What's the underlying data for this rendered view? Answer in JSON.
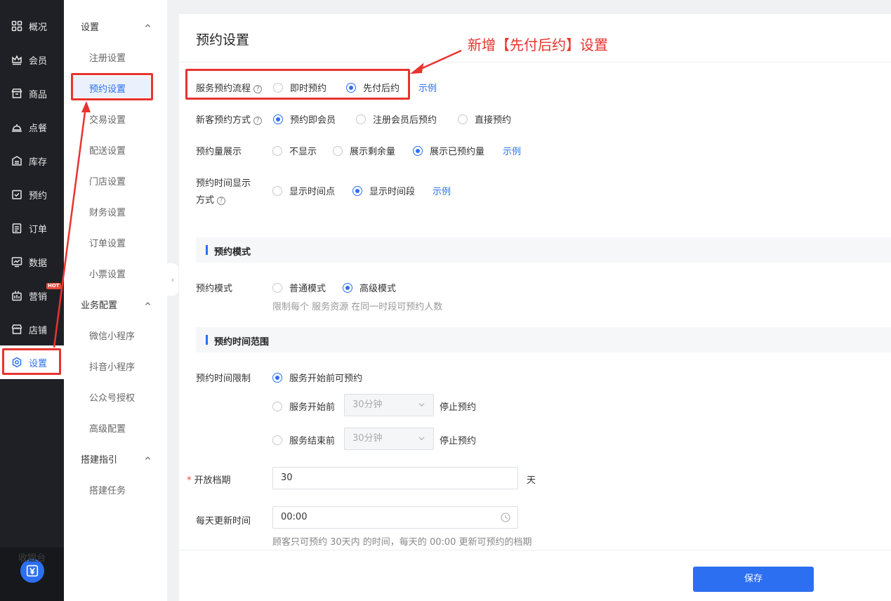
{
  "nav": {
    "items": [
      {
        "label": "概况",
        "icon": "grid-icon"
      },
      {
        "label": "会员",
        "icon": "crown-icon"
      },
      {
        "label": "商品",
        "icon": "store-icon"
      },
      {
        "label": "点餐",
        "icon": "cloche-icon"
      },
      {
        "label": "库存",
        "icon": "warehouse-icon"
      },
      {
        "label": "预约",
        "icon": "calendar-check-icon"
      },
      {
        "label": "订单",
        "icon": "clipboard-icon"
      },
      {
        "label": "数据",
        "icon": "chart-icon"
      },
      {
        "label": "营销",
        "icon": "marketing-icon",
        "badge": "HOT"
      },
      {
        "label": "店铺",
        "icon": "shop-icon"
      },
      {
        "label": "设置",
        "icon": "gear-icon",
        "active": true
      }
    ],
    "cashier": {
      "label": "收银台",
      "icon": "yen-icon"
    }
  },
  "sidebar": {
    "groups": [
      {
        "label": "设置",
        "items": [
          "注册设置",
          "预约设置",
          "交易设置",
          "配送设置",
          "门店设置",
          "财务设置",
          "订单设置",
          "小票设置"
        ]
      },
      {
        "label": "业务配置",
        "items": [
          "微信小程序",
          "抖音小程序",
          "公众号授权",
          "高级配置"
        ]
      },
      {
        "label": "搭建指引",
        "items": [
          "搭建任务"
        ]
      }
    ],
    "active_item": "预约设置"
  },
  "main": {
    "title": "预约设置",
    "flow": {
      "label": "服务预约流程",
      "options": [
        "即时预约",
        "先付后约"
      ],
      "selected": "先付后约",
      "example": "示例"
    },
    "new_customer": {
      "label": "新客预约方式",
      "options": [
        "预约即会员",
        "注册会员后预约",
        "直接预约"
      ],
      "selected": "预约即会员"
    },
    "volume": {
      "label": "预约量展示",
      "options": [
        "不显示",
        "展示剩余量",
        "展示已预约量"
      ],
      "selected": "展示已预约量",
      "example": "示例"
    },
    "time_display": {
      "label_line1": "预约时间显示",
      "label_line2": "方式",
      "options": [
        "显示时间点",
        "显示时间段"
      ],
      "selected": "显示时间段",
      "example": "示例"
    },
    "section_mode": "预约模式",
    "mode": {
      "label": "预约模式",
      "options": [
        "普通模式",
        "高级模式"
      ],
      "selected": "高级模式",
      "hint": "限制每个 服务资源 在同一时段可预约人数"
    },
    "section_range": "预约时间范围",
    "limit": {
      "label": "预约时间限制",
      "opt1": "服务开始前可预约",
      "opt2_prefix": "服务开始前",
      "opt2_value": "30分钟",
      "opt2_suffix": "停止预约",
      "opt3_prefix": "服务结束前",
      "opt3_value": "30分钟",
      "opt3_suffix": "停止预约",
      "selected": "服务开始前可预约"
    },
    "open_period": {
      "label": "开放档期",
      "required_mark": "*",
      "value": "30",
      "unit": "天"
    },
    "daily_update": {
      "label": "每天更新时间",
      "value": "00:00",
      "hint": "顾客只可预约 30天内 的时间，每天的 00:00 更新可预约的档期"
    },
    "save": "保存"
  },
  "annotation": {
    "text": "新增【先付后约】设置",
    "color": "#e8332f"
  },
  "colors": {
    "accent": "#2c6ff0",
    "nav_bg": "#1f2025",
    "annotation": "#e8332f"
  }
}
